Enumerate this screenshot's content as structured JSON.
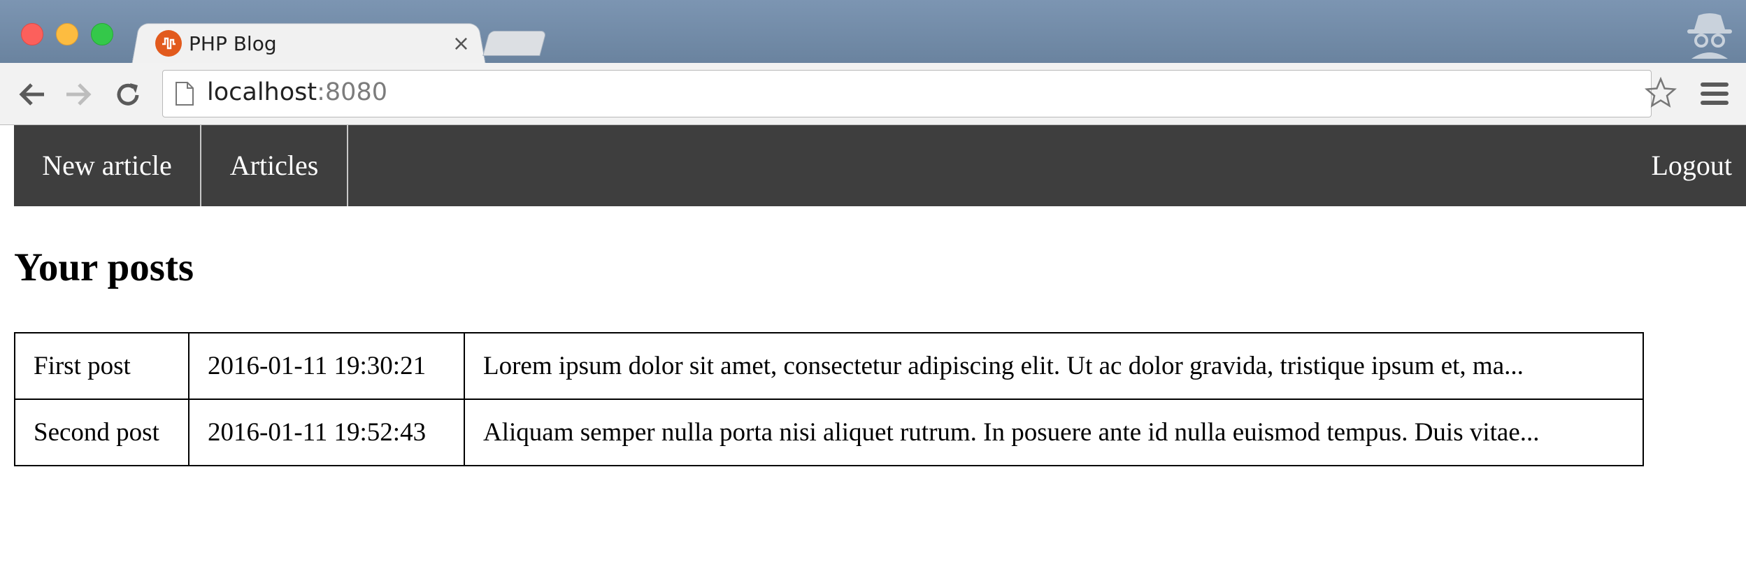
{
  "browser": {
    "tab_title": "PHP Blog",
    "tab_close": "×",
    "url_host": "localhost",
    "url_port": ":8080"
  },
  "navbar": {
    "new_article": "New article",
    "articles": "Articles",
    "logout": "Logout"
  },
  "main": {
    "title": "Your posts",
    "posts": [
      {
        "title": "First post",
        "date": "2016-01-11 19:30:21",
        "excerpt": "Lorem ipsum dolor sit amet, consectetur adipiscing elit. Ut ac dolor gravida, tristique ipsum et, ma..."
      },
      {
        "title": "Second post",
        "date": "2016-01-11 19:52:43",
        "excerpt": "Aliquam semper nulla porta nisi aliquet rutrum. In posuere ante id nulla euismod tempus. Duis vitae..."
      }
    ]
  },
  "colors": {
    "navbar_bg": "#3e3e3e",
    "tabstrip_bg": "#6f88a5",
    "favicon": "#e25a1d"
  },
  "icons": [
    "back-arrow-icon",
    "forward-arrow-icon",
    "reload-icon",
    "page-icon",
    "star-icon",
    "menu-icon",
    "incognito-icon",
    "php-logo-icon"
  ]
}
